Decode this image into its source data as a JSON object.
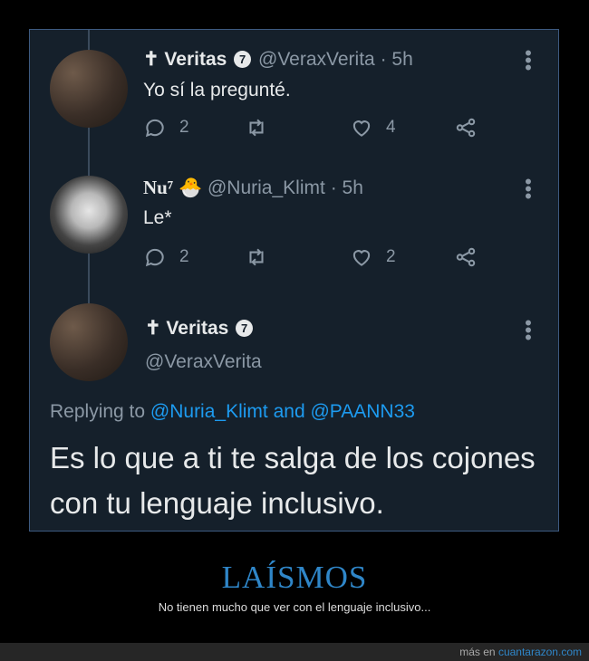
{
  "tweets": [
    {
      "name": "✝ Veritas",
      "badge": "7",
      "handle": "@VeraxVerita",
      "time": "· 5h",
      "text": "Yo sí la pregunté.",
      "replies": "2",
      "likes": "4"
    },
    {
      "name": "Nu⁷",
      "emoji": "🐣",
      "handle": "@Nuria_Klimt",
      "time": "· 5h",
      "text": "Le*",
      "replies": "2",
      "likes": "2"
    }
  ],
  "focused": {
    "name": "✝ Veritas",
    "badge": "7",
    "handle": "@VeraxVerita",
    "replying_prefix": "Replying to ",
    "replying_user1": "@Nuria_Klimt",
    "replying_and": " and ",
    "replying_user2": "@PAANN33",
    "text": "Es lo que a ti te salga de los cojones con tu lenguaje inclusivo."
  },
  "caption": {
    "title": "LAÍSMOS",
    "subtitle": "No tienen mucho que ver con el lenguaje inclusivo..."
  },
  "footer": {
    "prefix": "más en ",
    "site": "cuantarazon.com"
  },
  "icons": [
    "reply-icon",
    "retweet-icon",
    "like-icon",
    "share-icon",
    "more-icon"
  ],
  "colors": {
    "background": "#15202b",
    "link": "#1d9bf0",
    "caption_title": "#2f86c8"
  }
}
